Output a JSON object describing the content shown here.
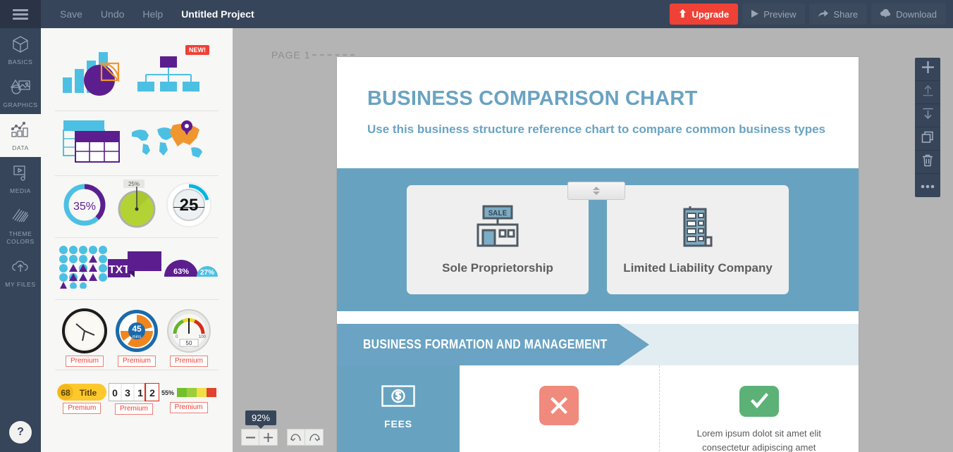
{
  "topbar": {
    "menu_icon": "hamburger-icon",
    "links": [
      {
        "label": "Save",
        "name": "save"
      },
      {
        "label": "Undo",
        "name": "undo"
      },
      {
        "label": "Help",
        "name": "help"
      }
    ],
    "project_title": "Untitled Project",
    "actions": [
      {
        "label": "Upgrade",
        "icon": "up-arrow-icon",
        "name": "upgrade",
        "accent": "#ef4136"
      },
      {
        "label": "Preview",
        "icon": "play-icon",
        "name": "preview"
      },
      {
        "label": "Share",
        "icon": "share-arrow-icon",
        "name": "share"
      },
      {
        "label": "Download",
        "icon": "cloud-down-icon",
        "name": "download"
      }
    ]
  },
  "sidebar": {
    "items": [
      {
        "label": "BASICS",
        "icon": "cube-icon",
        "active": false
      },
      {
        "label": "GRAPHICS",
        "icon": "image-shapes-icon",
        "active": false
      },
      {
        "label": "DATA",
        "icon": "chart-icon",
        "active": true
      },
      {
        "label": "MEDIA",
        "icon": "video-icon",
        "active": false
      },
      {
        "label": "THEME\nCOLORS",
        "icon": "hatch-icon",
        "active": false
      },
      {
        "label": "MY FILES",
        "icon": "cloud-up-icon",
        "active": false
      }
    ],
    "help_label": "?"
  },
  "panel": {
    "rows": [
      {
        "items": [
          {
            "name": "bar-pie-chart-thumb",
            "badge": null
          },
          {
            "name": "org-chart-thumb",
            "badge": "NEW!"
          }
        ]
      },
      {
        "items": [
          {
            "name": "table-thumb",
            "badge": null
          },
          {
            "name": "world-map-thumb",
            "badge": null
          }
        ]
      },
      {
        "items": [
          {
            "name": "donut-chart-thumb",
            "value": "35%"
          },
          {
            "name": "pie-gauge-thumb",
            "value": "25%"
          },
          {
            "name": "liquid-gauge-thumb",
            "value": "25"
          }
        ]
      },
      {
        "items": [
          {
            "name": "pictogram-thumb"
          },
          {
            "name": "text-box-thumb",
            "value": "TXT"
          },
          {
            "name": "half-donut-thumb",
            "value_a": "63%",
            "value_b": "27%"
          }
        ]
      },
      {
        "items": [
          {
            "name": "clock-thumb",
            "tag": "Premium"
          },
          {
            "name": "timer-45-thumb",
            "tag": "Premium",
            "value": "45",
            "unit": "mins"
          },
          {
            "name": "speedometer-thumb",
            "tag": "Premium",
            "value": "50",
            "min": "0",
            "max": "100"
          }
        ]
      },
      {
        "items": [
          {
            "name": "counter-title-thumb",
            "tag": "Premium",
            "value": "68",
            "label": "Title"
          },
          {
            "name": "odometer-thumb",
            "tag": "Premium",
            "digits": [
              "0",
              "3",
              "1",
              "2"
            ]
          },
          {
            "name": "progress-bar-thumb",
            "tag": "Premium",
            "value": "55%"
          }
        ]
      }
    ]
  },
  "canvas": {
    "page_label": "PAGE 1",
    "zoom_level": "92%",
    "zoom_out_icon": "minus-icon",
    "zoom_in_icon": "plus-icon",
    "undo_icon": "undo-arrow-icon",
    "redo_icon": "redo-arrow-icon"
  },
  "toolstrip": {
    "buttons": [
      {
        "name": "add-page-button",
        "icon": "plus-icon"
      },
      {
        "name": "move-up-button",
        "icon": "arrow-up-bar-icon"
      },
      {
        "name": "move-down-button",
        "icon": "arrow-down-bar-icon"
      },
      {
        "name": "duplicate-page-button",
        "icon": "copy-icon"
      },
      {
        "name": "delete-page-button",
        "icon": "trash-icon"
      },
      {
        "name": "more-options-button",
        "icon": "ellipsis-icon"
      }
    ]
  },
  "document": {
    "title": "BUSINESS COMPARISON CHART",
    "subtitle": "Use this business structure reference chart to compare common business types",
    "title_color": "#6aa3c3",
    "band_color": "#67a3c0",
    "cards": [
      {
        "label": "Sole Proprietorship",
        "icon": "storefront-sale-icon"
      },
      {
        "label": "Limited Liability Company",
        "icon": "office-building-icon"
      }
    ],
    "section_banner": "BUSINESS FORMATION AND MANAGEMENT",
    "row": {
      "label": "FEES",
      "label_icon": "dollar-bill-icon",
      "cells": [
        {
          "icon": "cross-mark-icon",
          "icon_color": "#ef8a7d",
          "text": ""
        },
        {
          "icon": "check-mark-icon",
          "icon_color": "#5cb176",
          "text": "Lorem ipsum dolot sit amet elit consectetur adipiscing amet"
        }
      ]
    }
  }
}
